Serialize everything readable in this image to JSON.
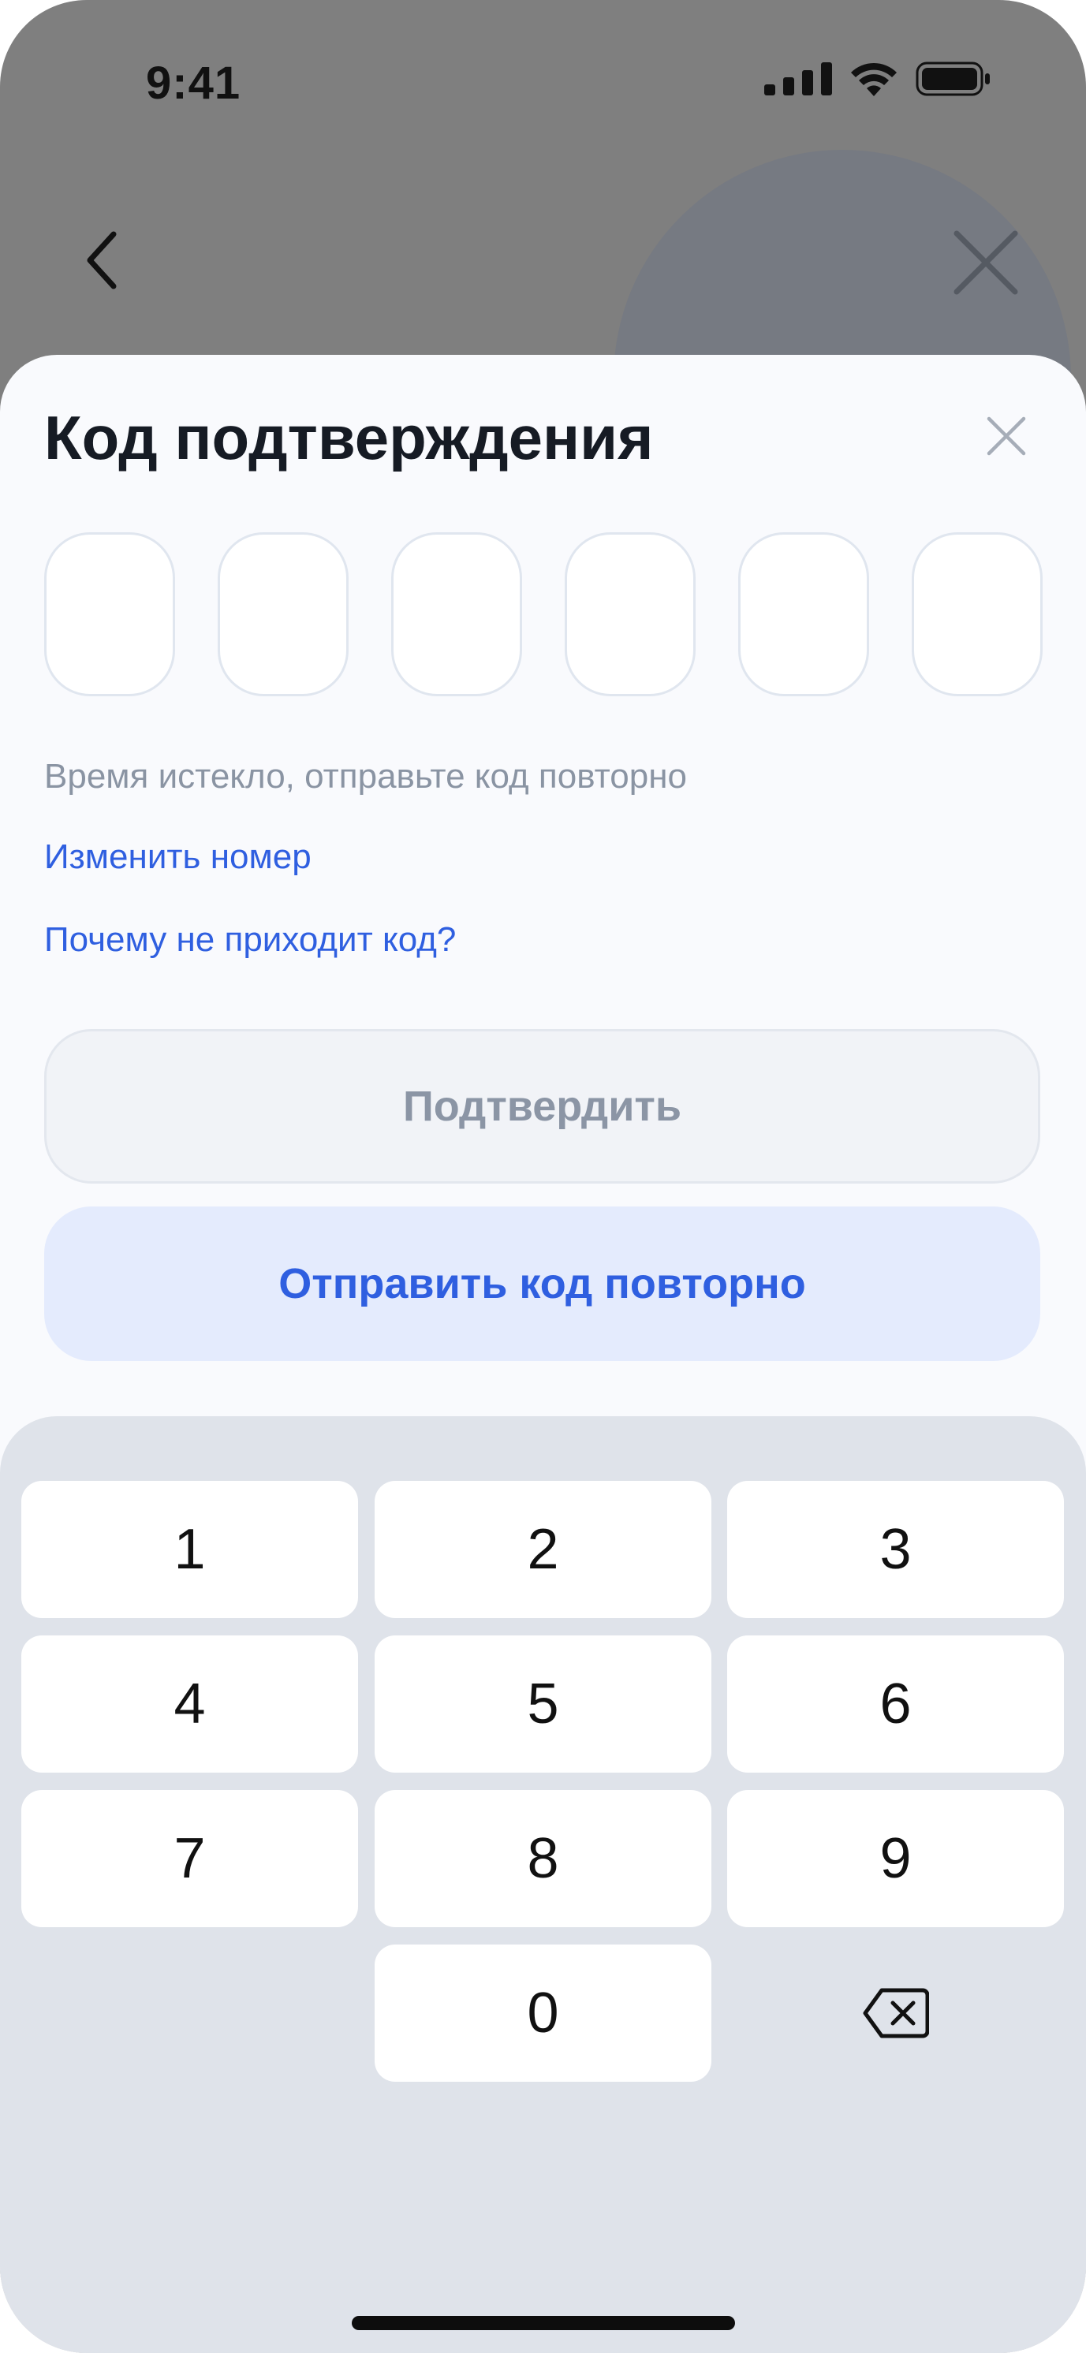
{
  "status_bar": {
    "time": "9:41"
  },
  "sheet": {
    "title": "Код подтверждения",
    "code_cells": [
      "",
      "",
      "",
      "",
      "",
      ""
    ],
    "expired_message": "Время истекло, отправьте код повторно",
    "change_number_link": "Изменить номер",
    "why_no_code_link": "Почему не приходит код?",
    "confirm_button": "Подтвердить",
    "resend_button": "Отправить код повторно"
  },
  "keypad": {
    "keys": [
      "1",
      "2",
      "3",
      "4",
      "5",
      "6",
      "7",
      "8",
      "9",
      "0"
    ],
    "delete_icon": "backspace-icon"
  },
  "colors": {
    "accent": "#2f5fe0",
    "sheet_background": "#f9fafd",
    "keypad_background": "#dfe3ea",
    "muted_text": "#8a94a3"
  }
}
